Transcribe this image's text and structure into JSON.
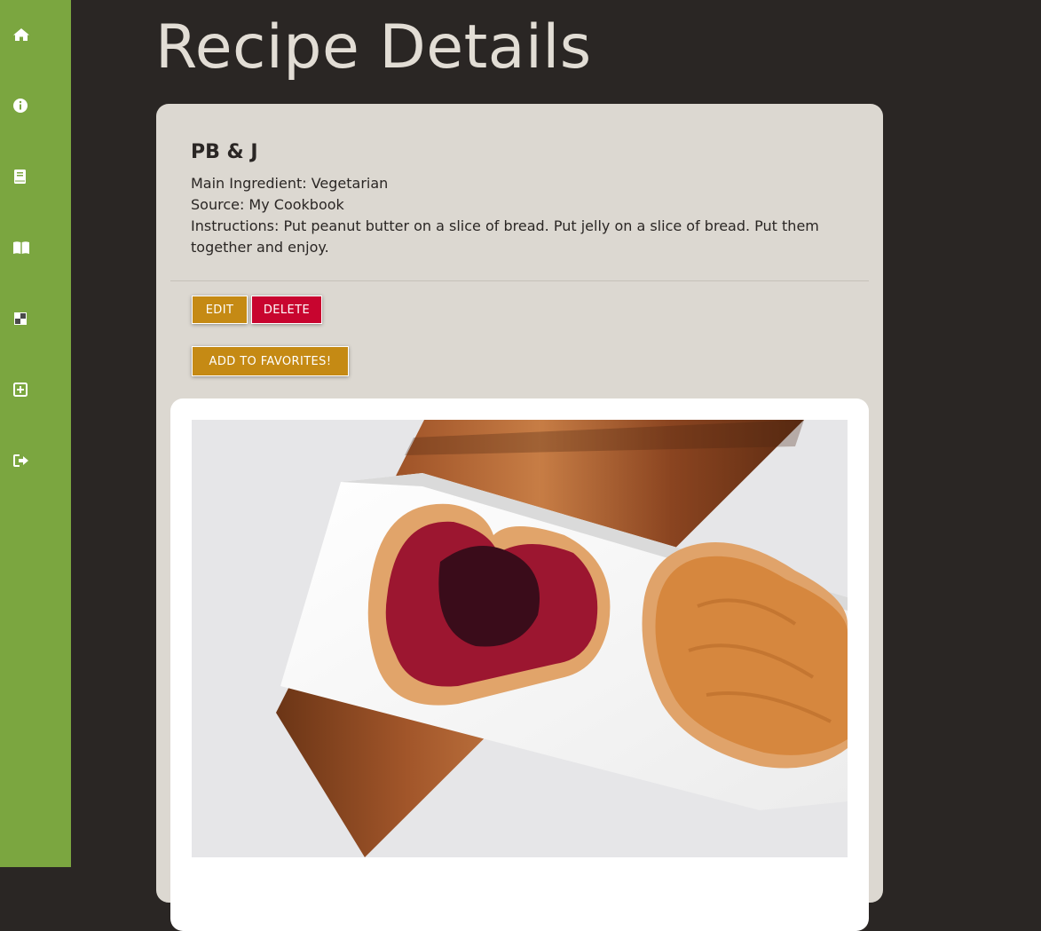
{
  "sidebar": {
    "items": [
      {
        "icon": "home-icon"
      },
      {
        "icon": "info-icon"
      },
      {
        "icon": "book-icon"
      },
      {
        "icon": "open-book-icon"
      },
      {
        "icon": "checkerboard-icon"
      },
      {
        "icon": "plus-square-icon"
      },
      {
        "icon": "sign-out-icon"
      }
    ]
  },
  "page": {
    "title": "Recipe Details"
  },
  "recipe": {
    "name": "PB & J",
    "main_ingredient": "Main Ingredient: Vegetarian",
    "source": "Source: My Cookbook",
    "instructions": "Instructions: Put peanut butter on a slice of bread. Put jelly on a slice of bread. Put them together and enjoy."
  },
  "actions": {
    "edit_label": "EDIT",
    "delete_label": "DELETE",
    "favorite_label": "ADD TO FAVORITES!"
  },
  "colors": {
    "sidebar": "#7ba640",
    "background": "#2a2624",
    "card": "#dcd8d1",
    "gold": "#c58a14",
    "red": "#c8052f"
  }
}
